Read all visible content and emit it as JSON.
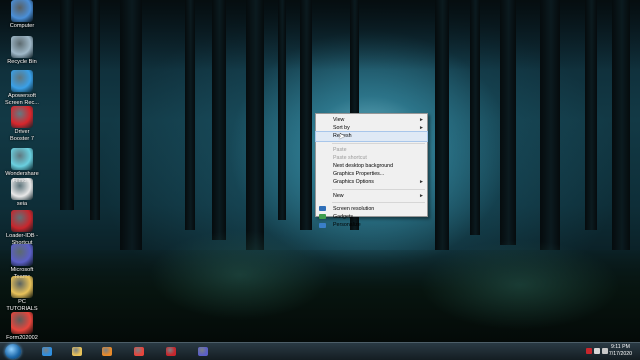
{
  "desktop_icons": [
    {
      "name": "computer",
      "label": "Computer",
      "icon": "computer-icon",
      "color": "#4a8fd8"
    },
    {
      "name": "recycle-bin",
      "label": "Recycle Bin",
      "icon": "recycle-bin-icon",
      "color": "#9fb8c8"
    },
    {
      "name": "apowersoft",
      "label": "Apowersoft\nScreen Rec...",
      "icon": "apowersoft-icon",
      "color": "#3aa0e8"
    },
    {
      "name": "driver-booster",
      "label": "Driver\nBooster 7",
      "icon": "driver-booster-icon",
      "color": "#d8262c"
    },
    {
      "name": "wondershare",
      "label": "Wondershare\nFilmora",
      "icon": "wondershare-icon",
      "color": "#6ad0e0"
    },
    {
      "name": "blank-file",
      "label": "seia",
      "icon": "file-icon",
      "color": "#e8e8e8"
    },
    {
      "name": "loader-idb",
      "label": "Loader-IDB -\nShortcut",
      "icon": "loader-icon",
      "color": "#c8262c"
    },
    {
      "name": "microsoft-teams",
      "label": "Microsoft\nTeams",
      "icon": "teams-icon",
      "color": "#5b5fc7"
    },
    {
      "name": "pc-tutorials",
      "label": "PC\nTUTORIALS",
      "icon": "folder-icon",
      "color": "#e8c25a"
    },
    {
      "name": "form",
      "label": "Form202002",
      "icon": "chrome-icon",
      "color": "#e8453c"
    }
  ],
  "context_menu": {
    "items": [
      {
        "name": "view",
        "label": "View",
        "arrow": "►",
        "disabled": false,
        "highlight": false,
        "icon": ""
      },
      {
        "name": "sort-by",
        "label": "Sort by",
        "arrow": "►",
        "disabled": false,
        "highlight": false,
        "icon": ""
      },
      {
        "name": "refresh",
        "label": "Refresh",
        "arrow": "",
        "disabled": false,
        "highlight": true,
        "icon": ""
      },
      {
        "sep": true
      },
      {
        "name": "paste",
        "label": "Paste",
        "arrow": "",
        "disabled": true,
        "highlight": false,
        "icon": ""
      },
      {
        "name": "paste-shortcut",
        "label": "Paste shortcut",
        "arrow": "",
        "disabled": true,
        "highlight": false,
        "icon": ""
      },
      {
        "name": "next-background",
        "label": "Next desktop background",
        "arrow": "",
        "disabled": false,
        "highlight": false,
        "icon": ""
      },
      {
        "name": "graphics-properties",
        "label": "Graphics Properties...",
        "arrow": "",
        "disabled": false,
        "highlight": false,
        "icon": ""
      },
      {
        "name": "graphics-options",
        "label": "Graphics Options",
        "arrow": "►",
        "disabled": false,
        "highlight": false,
        "icon": ""
      },
      {
        "sep": true
      },
      {
        "name": "new",
        "label": "New",
        "arrow": "►",
        "disabled": false,
        "highlight": false,
        "icon": ""
      },
      {
        "sep": true
      },
      {
        "name": "screen-resolution",
        "label": "Screen resolution",
        "arrow": "",
        "disabled": false,
        "highlight": false,
        "icon": "#2f6fb8"
      },
      {
        "name": "gadgets",
        "label": "Gadgets",
        "arrow": "",
        "disabled": false,
        "highlight": false,
        "icon": "#3e9e4e"
      },
      {
        "name": "personalize",
        "label": "Personalize",
        "arrow": "",
        "disabled": false,
        "highlight": false,
        "icon": "#3a7fc8"
      }
    ]
  },
  "taskbar": {
    "pinned": [
      {
        "name": "internet-explorer",
        "icon": "ie-icon",
        "color": "#2f8fe0"
      },
      {
        "name": "file-explorer",
        "icon": "folder-icon",
        "color": "#e8c25a"
      },
      {
        "name": "media-player",
        "icon": "media-player-icon",
        "color": "#e88a2a"
      },
      {
        "name": "chrome",
        "icon": "chrome-icon",
        "color": "#e8453c"
      },
      {
        "name": "driver-booster",
        "icon": "driver-booster-icon",
        "color": "#c8262c"
      },
      {
        "name": "teams",
        "icon": "teams-icon",
        "color": "#5b5fc7"
      }
    ],
    "clock": {
      "time": "9:11 PM",
      "date": "7/17/2020"
    }
  }
}
